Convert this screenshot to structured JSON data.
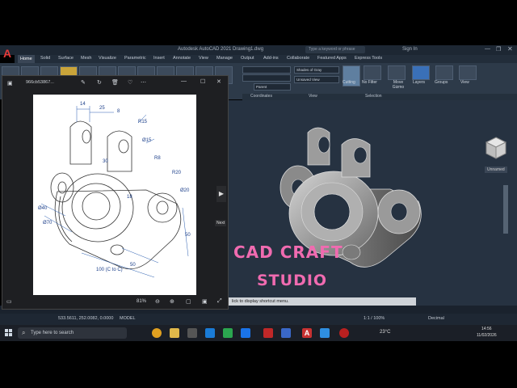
{
  "acad": {
    "title": "Autodesk AutoCAD 2021   Drawing1.dwg",
    "search_placeholder": "Type a keyword or phrase",
    "signin": "Sign In",
    "tabs": [
      "Home",
      "Solid",
      "Surface",
      "Mesh",
      "Visualize",
      "Parametric",
      "Insert",
      "Annotate",
      "View",
      "Manage",
      "Output",
      "Add-ins",
      "Collaborate",
      "Featured Apps",
      "Express Tools"
    ],
    "ribbon": {
      "shades": "Shades of Gray",
      "unsaved_view": "Unsaved View",
      "parent": "Parent",
      "cutting": "Cutting",
      "no_filter": "No Filter",
      "move_gizmo": "Move Gizmo",
      "layers": "Layers",
      "groups": "Groups",
      "view": "View"
    },
    "panels": [
      "Coordinates",
      "View",
      "Selection"
    ],
    "cube_label": "Unnamed",
    "cmdline": "lick to display shortcut menu.",
    "status": {
      "coords": "533.5611, 252.0082, 0.0000",
      "model": "MODEL",
      "scale": "1:1 / 100%",
      "units": "Decimal"
    }
  },
  "viewer": {
    "filename": "966cb53867...",
    "zoom": "81%",
    "next_tooltip": "Next",
    "dims": {
      "d14": "14",
      "d25": "25",
      "d8": "8",
      "r15": "R15",
      "r15b": "Ø15",
      "d30": "30",
      "d20": "Ø20",
      "r8": "R8",
      "r20": "R20",
      "d18": "18",
      "d40": "Ø40",
      "d70": "Ø70",
      "d50": "50",
      "d100": "100 (C to C)",
      "d50b": "50"
    }
  },
  "watermark": {
    "line1": "CAD CRAFT",
    "line2": "STUDIO"
  },
  "taskbar": {
    "search": "Type here to search",
    "weather": "23°C",
    "time": "14:56",
    "date": "11/02/2026"
  }
}
